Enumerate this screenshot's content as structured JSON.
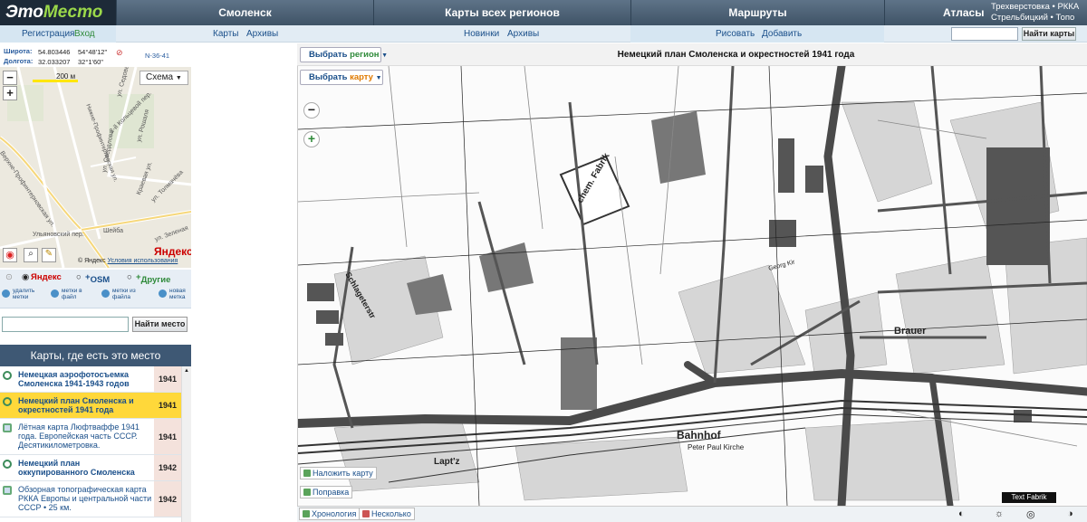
{
  "header": {
    "logo_prefix": "Это",
    "logo_accent": "Место",
    "nav": [
      "Смоленск",
      "Карты всех регионов",
      "Маршруты",
      "Атласы"
    ],
    "right_line1": "Трехверстовка • РККА",
    "right_line2": "Стрельбицкий • Топо"
  },
  "subnav": {
    "register": "Регистрация",
    "login": "Вход",
    "maps": "Карты",
    "archives": "Архивы",
    "news": "Новинки",
    "archives2": "Архивы",
    "draw": "Рисовать",
    "add": "Добавить",
    "search_button": "Найти карты"
  },
  "coords": {
    "lat_label": "Широта:",
    "lat_value": "54.803446",
    "lat_dms": "54°48'12\"",
    "lon_label": "Долгота:",
    "lon_value": "32.033207",
    "lon_dms": "32°1'60\"",
    "sheet": "N-36-41"
  },
  "minimap": {
    "scale": "200 м",
    "layer_select": "Схема",
    "zoom_out": "−",
    "zoom_in": "+",
    "streets": [
      "ул. Седова",
      "ул. Свердлова",
      "Нижне-Профинтерновская ул.",
      "Верхне-Профинтерновская ул.",
      "ул. Рошаля",
      "Краевая ул.",
      "ул. Толмачёва",
      "Шейба",
      "ул. Зеленая",
      "Ульяновский пер.",
      "2-й Кольцевой пер."
    ],
    "brand": "Яндекс",
    "footer_copy": "© Яндекс",
    "footer_terms": "Условия использования"
  },
  "providers": {
    "yandex": "Яндекс",
    "osm": "OSM",
    "other": "Другие"
  },
  "tools": [
    {
      "line1": "удалить",
      "line2": "метки"
    },
    {
      "line1": "метки в",
      "line2": "файл"
    },
    {
      "line1": "метки из",
      "line2": "файла"
    },
    {
      "line1": "новая",
      "line2": "метка"
    }
  ],
  "place_search": {
    "button": "Найти место",
    "value": ""
  },
  "maps_list": {
    "header": "Карты, где есть это место",
    "items": [
      {
        "title": "Немецкая аэрофотосъемка Смоленска 1941-1943 годов",
        "year": "1941"
      },
      {
        "title": "Немецкий план Смоленска и окрестностей 1941 года",
        "year": "1941"
      },
      {
        "title": "Лётная карта Люфтваффе 1941 года. Европейская часть СССР. Десятикилометровка.",
        "year": "1941"
      },
      {
        "title": "Немецкий план оккупированного Смоленска",
        "year": "1942"
      },
      {
        "title": "Обзорная топографическая карта РККА Европы и центральной части СССР • 25 км.",
        "year": "1942"
      }
    ]
  },
  "map": {
    "title": "Немецкий план Смоленска и окрестностей 1941 года",
    "select_region_prefix": "Выбрать ",
    "select_region_word": "регион",
    "select_map_prefix": "Выбрать ",
    "select_map_word": "карту",
    "overlay_btn": "Наложить карту",
    "fix_btn": "Поправка",
    "chronology_btn": "Хронология",
    "several_btn": "Несколько",
    "labels": [
      "chem. Fabrik",
      "Schlageterstr",
      "Bahnhof",
      "Peter Paul Kirche",
      "Brauer",
      "Lapt'z",
      "Text Fabrik",
      "Georg Kir"
    ],
    "zoom_out": "−",
    "zoom_in": "+"
  },
  "colors": {
    "topbar": "#4e6276",
    "accent_green": "#9bd94a",
    "highlight_row": "#ffd83a",
    "year_bg": "#f4e2dc"
  }
}
